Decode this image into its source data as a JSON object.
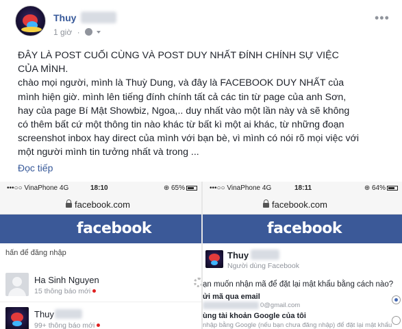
{
  "post": {
    "author": "Thuy",
    "time": "1 giờ",
    "separator": "·",
    "text_lines": [
      "ĐÂY LÀ POST CUỐI CÙNG VÀ POST DUY NHẤT ĐÍNH CHÍNH SỰ VIỆC",
      "CỦA MÌNH.",
      "chào mọi người, mình là Thuỳ Dung, và đây là FACEBOOK DUY NHẤT của",
      "mình hiện giờ. mình lên tiếng đính chính tất cả các tin từ page của anh Sơn,",
      "hay của page Bí Mật Showbiz, Ngoa,.. duy nhất vào một lần này và sẽ không",
      "có thêm bất cứ một thông tin nào khác từ bất kì một ai khác, từ những đoạn",
      "screenshot inbox hay direct của mình với bạn bè, vì mình có nói rõ mọi việc với",
      "một người mình tin tưởng nhất và trong ..."
    ],
    "see_more": "Đọc tiếp",
    "more_menu": "•••"
  },
  "screenshots": [
    {
      "status": {
        "carrier": "•••○○ VinaPhone  4G",
        "time": "18:10",
        "battery": "⊕ 65%"
      },
      "url": "facebook.com",
      "logo": "facebook",
      "login_hint": "hấn để đăng nhập",
      "accounts": [
        {
          "name": "Ha Sinh Nguyen",
          "notifications": "15 thông báo mới"
        },
        {
          "name": "Thuy",
          "notifications": "99+ thông báo mới"
        }
      ]
    },
    {
      "status": {
        "carrier": "•••○○ VinaPhone  4G",
        "time": "18:11",
        "battery": "⊕ 64%"
      },
      "url": "facebook.com",
      "logo": "facebook",
      "profile": {
        "name": "Thuy",
        "subtitle": "Người dùng Facebook"
      },
      "reset_question": "ạn muốn nhận mã để đặt lại mật khẩu bằng cách nào?",
      "options": [
        {
          "title": "ửi mã qua email",
          "detail": "0@gmail.com"
        },
        {
          "title": "ùng tài khoản Google của tôi",
          "detail": "nhập bằng Google (nếu bạn chưa đăng nhập) để đặt lại mật khẩu"
        }
      ]
    }
  ],
  "colors": {
    "link": "#365899",
    "facebook_blue": "#3b5998",
    "muted": "#90949c",
    "notification_dot": "#e02020"
  }
}
